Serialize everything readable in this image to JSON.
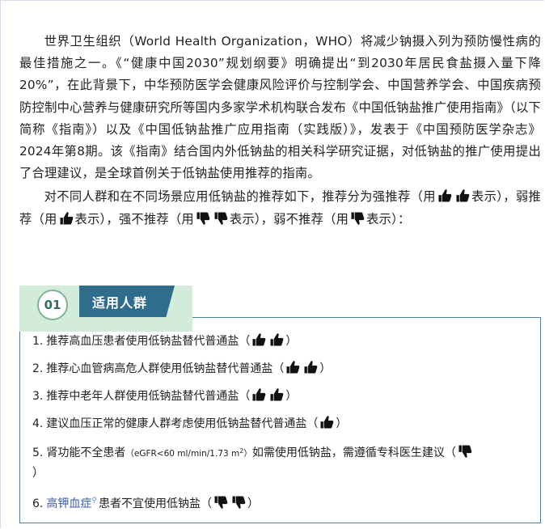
{
  "intro": {
    "p1": "世界卫生组织（World Health Organization，WHO）将减少钠摄入列为预防慢性病的最佳措施之一。《“健康中国2030”规划纲要》明确提出“到2030年居民食盐摄入量下降20%”，在此背景下，中华预防医学会健康风险评价与控制学会、中国营养学会、中国疾病预防控制中心营养与健康研究所等国内多家学术机构联合发布《中国低钠盐推广使用指南》（以下简称《指南》）以及《中国低钠盐推广应用指南（实践版）》，发表于《中国预防医学杂志》2024年第8期。该《指南》结合国内外低钠盐的相关科学研究证据，对低钠盐的推广使用提出了合理建议，是全球首例关于低钠盐使用推荐的指南。",
    "p2_a": "对不同人群和在不同场景应用低钠盐的推荐如下，推荐分为强推荐（用",
    "p2_b": "表示），弱推荐（用",
    "p2_c": "表示），强不推荐（用",
    "p2_d": "表示），弱不推荐（用",
    "p2_e": "表示）："
  },
  "section": {
    "number": "01",
    "title": "适用人群"
  },
  "recommendations": [
    {
      "num": "1.",
      "text": "推荐高血压患者使用低钠盐替代普通盐（",
      "close": "）",
      "icons": "thumb-up, thumb-up"
    },
    {
      "num": "2.",
      "text": "推荐心血管病高危人群使用低钠盐替代普通盐（",
      "close": "）",
      "icons": "thumb-up, thumb-up"
    },
    {
      "num": "3.",
      "text": "推荐中老年人群使用低钠盐替代普通盐（",
      "close": "）",
      "icons": "thumb-up, thumb-up"
    },
    {
      "num": "4.",
      "text": "建议血压正常的健康人群考虑使用低钠盐替代普通盐（",
      "close": "）",
      "icons": "thumb-up"
    },
    {
      "num": "5.",
      "text_a": "肾功能不全患者",
      "egfr": "（eGFR<60 ml/min/1.73 m",
      "egfr_sup": "2",
      "egfr_close": "）",
      "text_b": "如需使用低钠盐，需遵循专科医生建议（",
      "close": "）",
      "icons": "thumb-down"
    },
    {
      "num": "6.",
      "link": "高钾血症",
      "text": "患者不宜使用低钠盐（",
      "close": "）",
      "icons": "thumb-down, thumb-down"
    }
  ],
  "colors": {
    "header_bg": "#d3ecd9",
    "tag_bg": "#2e6e8c",
    "badge_text": "#2f6f60",
    "box_border": "#4f7f94",
    "link": "#3b5ea8"
  }
}
